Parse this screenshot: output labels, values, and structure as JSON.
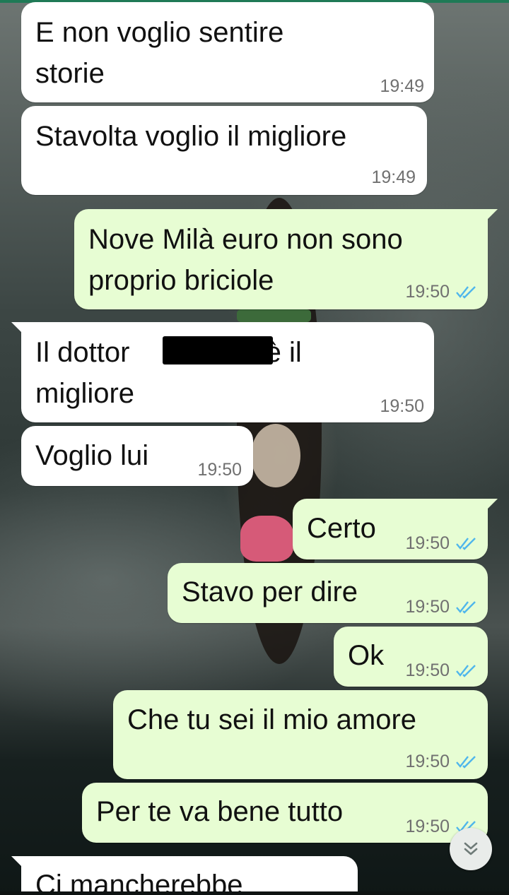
{
  "messages": [
    {
      "id": "m1",
      "direction": "incoming",
      "text_lines": [
        "E non voglio sentire",
        "storie"
      ],
      "time": "19:49"
    },
    {
      "id": "m2",
      "direction": "incoming",
      "text_lines": [
        "Stavolta voglio il migliore"
      ],
      "time": "19:49"
    },
    {
      "id": "m3",
      "direction": "outgoing",
      "text_lines": [
        "Nove Milà euro non sono",
        "proprio briciole"
      ],
      "time": "19:50",
      "status": "read"
    },
    {
      "id": "m4",
      "direction": "incoming",
      "text_lines": [
        "Il dottor",
        "è il",
        "migliore"
      ],
      "time": "19:50",
      "redacted": true
    },
    {
      "id": "m5",
      "direction": "incoming",
      "text_lines": [
        "Voglio lui"
      ],
      "time": "19:50"
    },
    {
      "id": "m6",
      "direction": "outgoing",
      "text_lines": [
        "Certo"
      ],
      "time": "19:50",
      "status": "read"
    },
    {
      "id": "m7",
      "direction": "outgoing",
      "text_lines": [
        "Stavo per dire"
      ],
      "time": "19:50",
      "status": "read"
    },
    {
      "id": "m8",
      "direction": "outgoing",
      "text_lines": [
        "Ok"
      ],
      "time": "19:50",
      "status": "read"
    },
    {
      "id": "m9",
      "direction": "outgoing",
      "text_lines": [
        "Che tu sei il mio amore"
      ],
      "time": "19:50",
      "status": "read"
    },
    {
      "id": "m10",
      "direction": "outgoing",
      "text_lines": [
        "Per te va bene tutto"
      ],
      "time": "19:50",
      "status": "read"
    },
    {
      "id": "m11",
      "direction": "incoming",
      "text_lines": [
        "Ci mancherebbe"
      ],
      "time": ""
    }
  ],
  "icons": {
    "read_ticks": "double-check-icon",
    "scroll_down": "double-chevron-down-icon"
  },
  "colors": {
    "incoming_bubble": "#ffffff",
    "outgoing_bubble": "#e7fdd3",
    "read_tick": "#4fb6ec",
    "timestamp": "#707070",
    "accent": "#1f7a56"
  }
}
